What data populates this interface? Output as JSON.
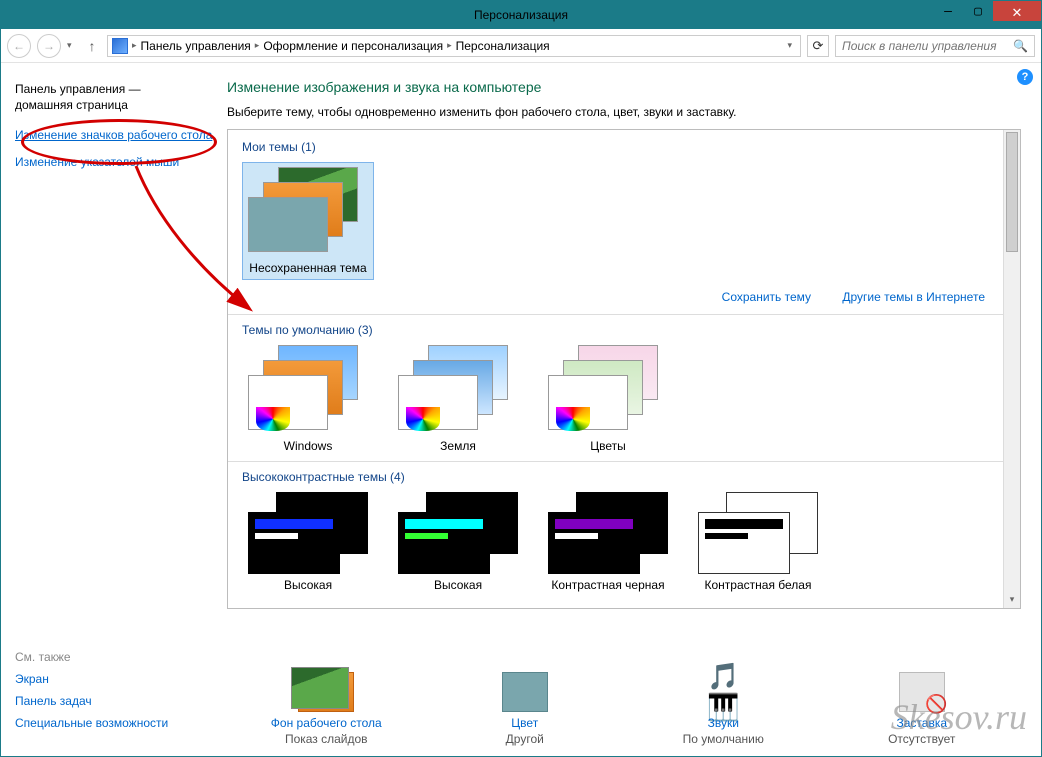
{
  "window": {
    "title": "Персонализация"
  },
  "nav": {
    "breadcrumb": [
      "Панель управления",
      "Оформление и персонализация",
      "Персонализация"
    ],
    "search_placeholder": "Поиск в панели управления"
  },
  "sidebar": {
    "home_line1": "Панель управления —",
    "home_line2": "домашняя страница",
    "links": [
      {
        "label": "Изменение значков рабочего стола",
        "active": true
      },
      {
        "label": "Изменение указателей мыши",
        "active": false
      }
    ],
    "see_also_header": "См. также",
    "see_also": [
      "Экран",
      "Панель задач",
      "Специальные возможности"
    ]
  },
  "main": {
    "title": "Изменение изображения и звука на компьютере",
    "subtitle": "Выберите тему, чтобы одновременно изменить фон рабочего стола, цвет, звуки и заставку.",
    "my_themes_header": "Мои темы (1)",
    "my_themes": [
      {
        "label": "Несохраненная тема"
      }
    ],
    "save_theme": "Сохранить тему",
    "more_themes": "Другие темы в Интернете",
    "default_header": "Темы по умолчанию (3)",
    "default_themes": [
      {
        "label": "Windows"
      },
      {
        "label": "Земля"
      },
      {
        "label": "Цветы"
      }
    ],
    "hc_header": "Высококонтрастные темы (4)",
    "hc_themes": [
      {
        "label": "Высокая"
      },
      {
        "label": "Высокая"
      },
      {
        "label": "Контрастная черная"
      },
      {
        "label": "Контрастная белая"
      }
    ]
  },
  "bottom": {
    "items": [
      {
        "title": "Фон рабочего стола",
        "sub": "Показ слайдов"
      },
      {
        "title": "Цвет",
        "sub": "Другой"
      },
      {
        "title": "Звуки",
        "sub": "По умолчанию"
      },
      {
        "title": "Заставка",
        "sub": "Отсутствует"
      }
    ]
  },
  "watermark": "Skesov.ru"
}
